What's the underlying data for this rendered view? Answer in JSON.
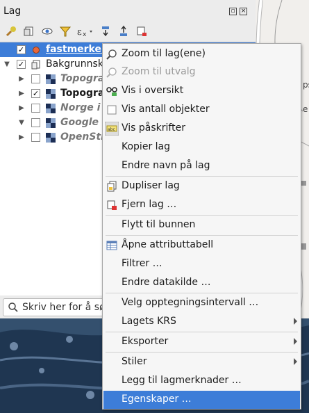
{
  "panel": {
    "title": "Lag",
    "search_placeholder": "Skriv her for å søk"
  },
  "layers": [
    {
      "label": "fastmerker",
      "checked": true,
      "expanded": false,
      "selected": true,
      "style": "bold-underline",
      "icon": "point-layer-icon"
    },
    {
      "label": "Bakgrunnska",
      "checked": true,
      "expanded": true,
      "style": "normal",
      "icon": "group-icon"
    },
    {
      "label": "Topografi",
      "checked": false,
      "expanded": false,
      "style": "italic-bold",
      "icon": "raster-icon"
    },
    {
      "label": "Topograf",
      "checked": true,
      "expanded": false,
      "style": "bold",
      "icon": "raster-icon"
    },
    {
      "label": "Norge i B",
      "checked": false,
      "expanded": false,
      "style": "italic-bold",
      "icon": "raster-icon"
    },
    {
      "label": "Google E",
      "checked": false,
      "expanded": true,
      "style": "italic-bold",
      "icon": "raster-icon"
    },
    {
      "label": "OpenStre",
      "checked": false,
      "expanded": false,
      "style": "italic-bold",
      "icon": "raster-icon"
    }
  ],
  "menu": {
    "items": [
      {
        "label": "Zoom til lag(ene)",
        "icon": "zoom-layer-icon",
        "enabled": true
      },
      {
        "label": "Zoom til utvalg",
        "icon": "zoom-selection-icon",
        "enabled": false
      },
      {
        "label": "Vis i oversikt",
        "icon": "overview-icon",
        "enabled": true
      },
      {
        "label": "Vis antall objekter",
        "icon": "checkbox-icon",
        "enabled": true
      },
      {
        "label": "Vis påskrifter",
        "icon": "labels-icon",
        "enabled": true
      },
      {
        "label": "Kopier lag",
        "enabled": true
      },
      {
        "label": "Endre navn på lag",
        "enabled": true
      },
      {
        "label": "Dupliser lag",
        "icon": "duplicate-icon",
        "enabled": true
      },
      {
        "label": "Fjern lag …",
        "icon": "remove-icon",
        "enabled": true
      },
      {
        "label": "Flytt til bunnen",
        "enabled": true
      },
      {
        "label": "Åpne attributtabell",
        "icon": "table-icon",
        "enabled": true
      },
      {
        "label": "Filtrer …",
        "enabled": true
      },
      {
        "label": "Endre datakilde …",
        "enabled": true
      },
      {
        "label": "Velg opptegningsintervall …",
        "enabled": true
      },
      {
        "label": "Lagets KRS",
        "submenu": true,
        "enabled": true
      },
      {
        "label": "Eksporter",
        "submenu": true,
        "enabled": true
      },
      {
        "label": "Stiler",
        "submenu": true,
        "enabled": true
      },
      {
        "label": "Legg til lagmerknader …",
        "enabled": true
      },
      {
        "label": "Egenskaper …",
        "enabled": true,
        "active": true
      }
    ]
  },
  "map_labels": [
    "ps",
    "e"
  ],
  "colors": {
    "selection": "#3d7dd8",
    "point_symbol": "#e8673a"
  }
}
